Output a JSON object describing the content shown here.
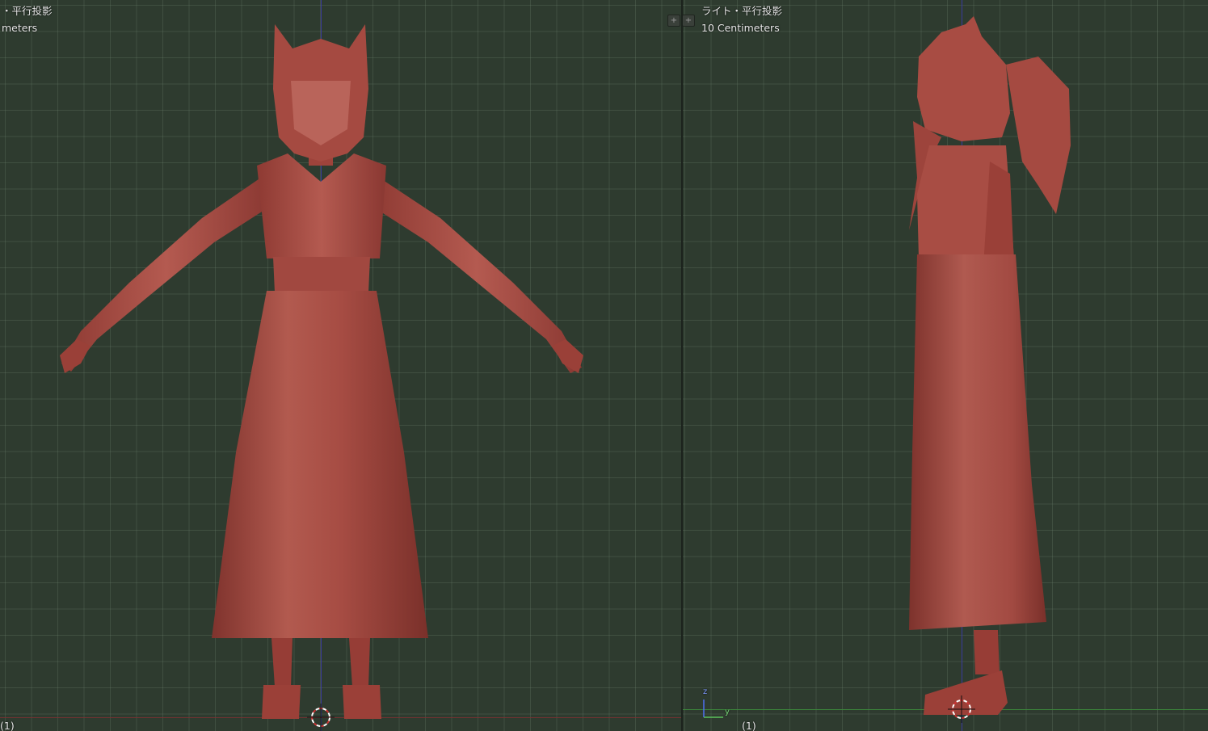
{
  "left_viewport": {
    "view_label": "・平行投影",
    "scale_label": "meters",
    "frame_label": "(1)"
  },
  "right_viewport": {
    "view_label": "ライト・平行投影",
    "scale_label": "10 Centimeters",
    "frame_label": "(1)",
    "axis_gizmo": {
      "z_label": "z",
      "y_label": "y"
    }
  },
  "colors": {
    "viewport_bg": "#2e3b2f",
    "model": "#a84a42",
    "z_axis": "#3b3bb0",
    "x_axis": "#7a3232",
    "y_axis": "#3c8a3c"
  },
  "icons": {
    "cursor": "3d-cursor-icon",
    "split": "area-split-icon"
  }
}
